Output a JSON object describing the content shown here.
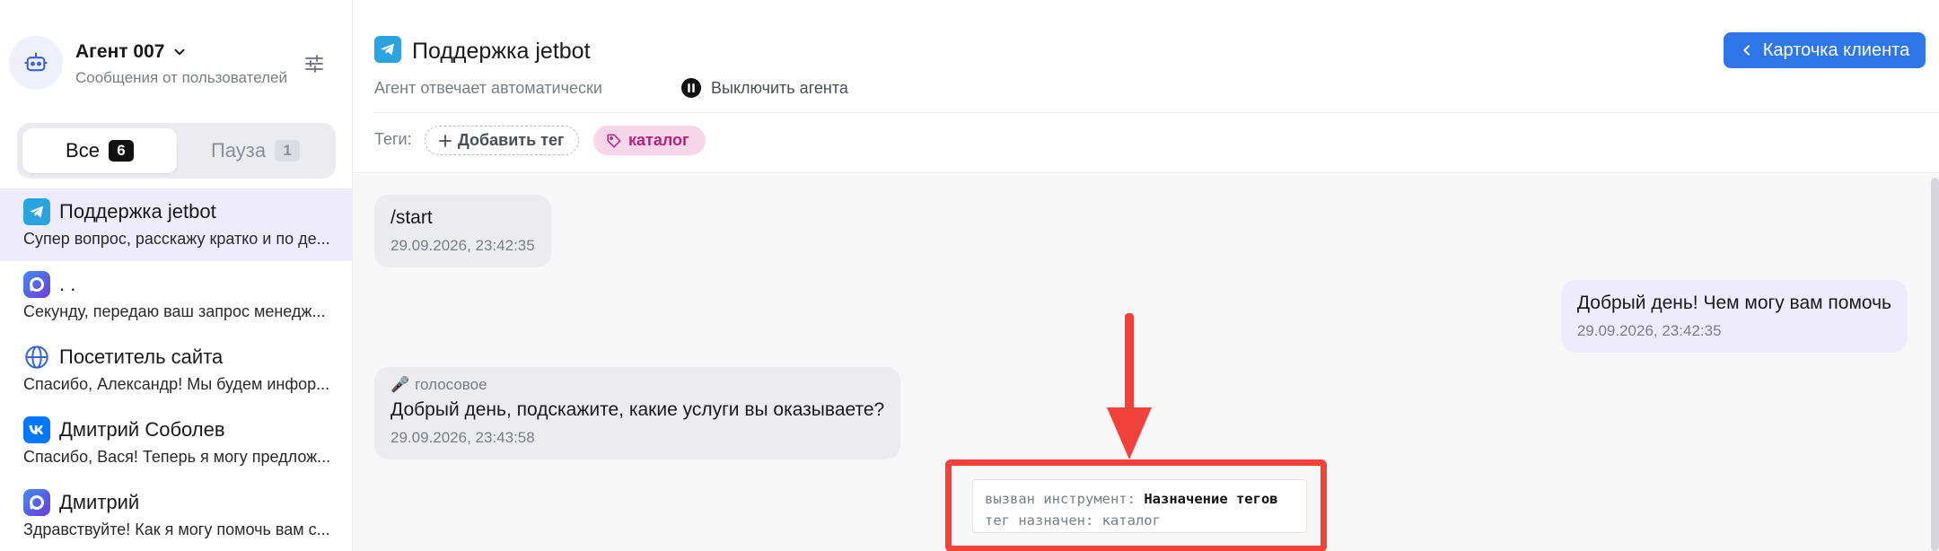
{
  "agent": {
    "name": "Агент 007",
    "subtitle": "Сообщения от пользователей"
  },
  "tabs": [
    {
      "label": "Все",
      "count": "6"
    },
    {
      "label": "Пауза",
      "count": "1"
    }
  ],
  "chats": [
    {
      "icon": "telegram-icon",
      "title": "Поддержка jetbot",
      "preview": "Супер вопрос, расскажу кратко и по де..."
    },
    {
      "icon": "max-messenger-icon",
      "title": ". .",
      "preview": "Секунду, передаю ваш запрос менедж..."
    },
    {
      "icon": "globe-icon",
      "title": "Посетитель сайта",
      "preview": "Спасибо, Александр! Мы будем инфор..."
    },
    {
      "icon": "vk-icon",
      "title": "Дмитрий Соболев",
      "preview": "Спасибо, Вася! Теперь я могу предлож..."
    },
    {
      "icon": "max-messenger-icon",
      "title": "Дмитрий",
      "preview": "Здравствуйте! Как я могу помочь вам с..."
    }
  ],
  "header": {
    "title": "Поддержка jetbot",
    "auto_text": "Агент отвечает автоматически",
    "disable_label": "Выключить агента",
    "tags_label": "Теги:",
    "add_tag_label": "Добавить тег",
    "tag": "каталог",
    "client_card_label": "Карточка клиента"
  },
  "messages": [
    {
      "direction": "in",
      "text": "/start",
      "time": "29.09.2026, 23:42:35"
    },
    {
      "direction": "out",
      "text": "Добрый день! Чем могу вам помочь",
      "time": "29.09.2026, 23:42:35"
    },
    {
      "direction": "in",
      "voice_label": "голосовое",
      "text": "Добрый день, подскажите, какие услуги вы оказываете?",
      "time": "29.09.2026, 23:43:58"
    }
  ],
  "tool_call": {
    "line1_prefix": "вызван инструмент:",
    "line1_value": "Назначение тегов",
    "line2": "тег назначен: каталог"
  },
  "colors": {
    "accent": "#2f76e8",
    "selected_bg": "#eeecfc",
    "tag_bg": "#f8d6ea",
    "tag_text": "#b3227a",
    "highlight": "#f2403a"
  }
}
